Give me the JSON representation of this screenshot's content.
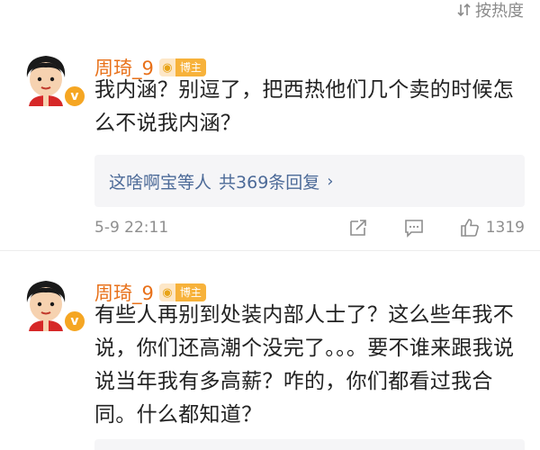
{
  "sort": {
    "label": "按热度",
    "icon": "sort-icon"
  },
  "comments": [
    {
      "username": "周琦_9",
      "badge": "博主",
      "text": "我内涵？别逗了，把西热他们几个卖的时候怎么不说我内涵？",
      "reply_preview": {
        "names": "这啥啊宝等人",
        "count": "共369条回复",
        "chevron": "›"
      },
      "timestamp": "5-9 22:11",
      "like_count": "1319"
    },
    {
      "username": "周琦_9",
      "badge": "博主",
      "text": "有些人再别到处装内部人士了？这么些年我不说，你们还高潮个没完了。。。要不谁来跟我说说当年我有多高薪？咋的，你们都看过我合同。什么都知道？"
    }
  ],
  "colors": {
    "username": "#e8711a",
    "reply_link": "#4c6a98",
    "badge": "#f7b23b",
    "meta": "#8e8e8e"
  }
}
